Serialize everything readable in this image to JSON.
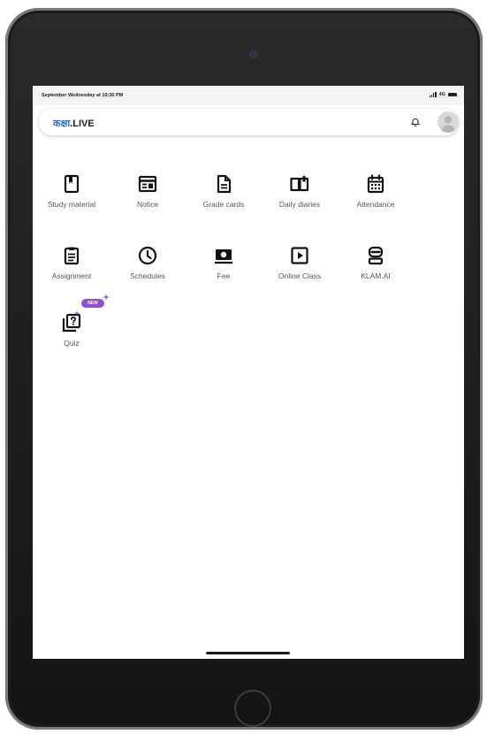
{
  "status_bar": {
    "time_text": "September Wednesday at 10:30 PM",
    "network": "4G",
    "icons": [
      "signal-icon",
      "battery-icon"
    ]
  },
  "app_bar": {
    "logo_devanagari": "कक्षा",
    "logo_suffix": ".LIVE",
    "icons": [
      "bell-icon",
      "avatar-icon"
    ],
    "accent_color": "#2a6dd9"
  },
  "menu": {
    "items": [
      {
        "label": "Study material",
        "icon": "bookmark-icon"
      },
      {
        "label": "Notice",
        "icon": "notice-board-icon"
      },
      {
        "label": "Grade cards",
        "icon": "document-icon"
      },
      {
        "label": "Daily diaries",
        "icon": "open-book-icon"
      },
      {
        "label": "Attendance",
        "icon": "calendar-icon"
      },
      {
        "label": "Assignment",
        "icon": "clipboard-icon"
      },
      {
        "label": "Schedules",
        "icon": "clock-icon"
      },
      {
        "label": "Fee",
        "icon": "money-icon"
      },
      {
        "label": "Online Class",
        "icon": "play-icon"
      },
      {
        "label": "KLAM.AI",
        "icon": "robot-icon"
      },
      {
        "label": "Quiz",
        "icon": "quiz-icon",
        "badge": "NEW"
      }
    ],
    "badge_color": "#8e4fc9"
  }
}
